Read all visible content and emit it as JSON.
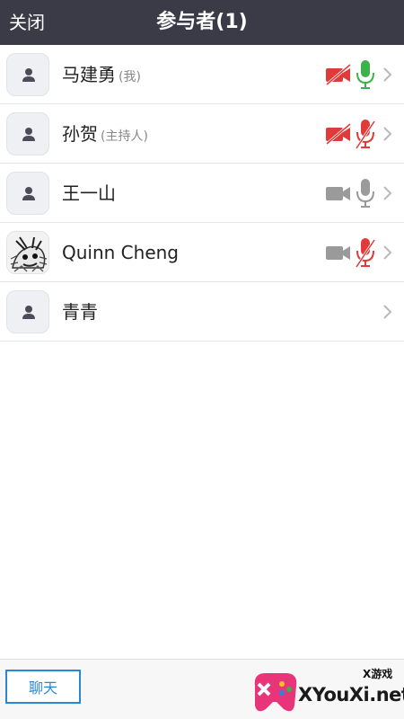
{
  "header": {
    "close_label": "关闭",
    "title": "参与者(1)"
  },
  "participants": [
    {
      "name": "马建勇",
      "tag": "(我)",
      "camera": "off",
      "mic": "on"
    },
    {
      "name": "孙贺",
      "tag": "(主持人)",
      "camera": "off",
      "mic": "off"
    },
    {
      "name": "王一山",
      "tag": "",
      "camera": "idle",
      "mic": "idle"
    },
    {
      "name": "Quinn Cheng",
      "tag": "",
      "camera": "idle",
      "mic": "off"
    },
    {
      "name": "青青",
      "tag": "",
      "camera": "none",
      "mic": "none"
    }
  ],
  "footer": {
    "chat_label": "聊天"
  },
  "watermark": {
    "line1": "X游戏",
    "line2": "XYouXi.net"
  },
  "colors": {
    "header_bg": "#3b3b48",
    "muted_red": "#e03a3a",
    "active_green": "#3db24a",
    "idle_gray": "#9a9a9a",
    "accent_blue": "#2a87d8"
  }
}
